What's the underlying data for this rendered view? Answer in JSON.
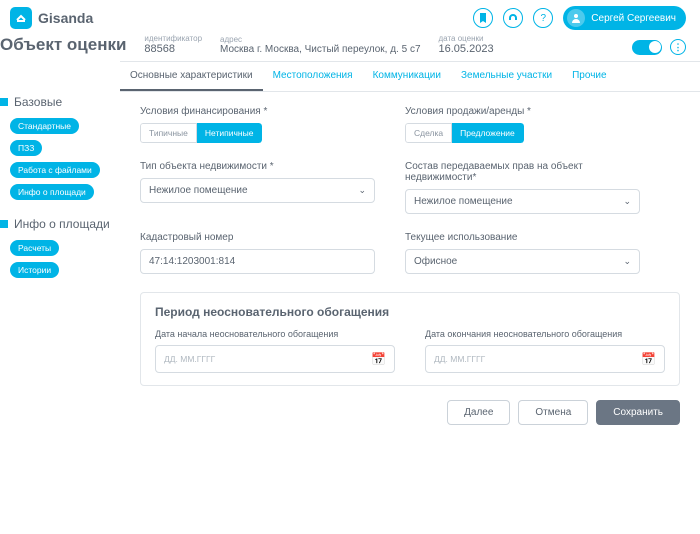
{
  "brand": "Gisanda",
  "header_icons": {
    "bookmark": "bookmark",
    "headset": "support",
    "help": "?"
  },
  "user_name": "Сергей Сергеевич",
  "page_title": "Объект оценки",
  "meta": {
    "id_label": "идентификатор",
    "id_value": "88568",
    "address_label": "адрес",
    "address_value": "Москва г. Москва, Чистый переулок, д. 5 с7",
    "date_label": "дата оценки",
    "date_value": "16.05.2023"
  },
  "sidebar": {
    "group1": {
      "title": "Базовые",
      "items": [
        "Стандартные",
        "ПЗЗ",
        "Работа с файлами",
        "Инфо о площади"
      ]
    },
    "group2": {
      "title": "Инфо о площади",
      "items": [
        "Расчеты",
        "Истории"
      ]
    }
  },
  "tabs": [
    "Основные характеристики",
    "Местоположения",
    "Коммуникации",
    "Земельные участки",
    "Прочие"
  ],
  "form": {
    "financing": {
      "label": "Условия финансирования *",
      "opts": [
        "Типичные",
        "Нетипичные"
      ],
      "selected": 1
    },
    "sale": {
      "label": "Условия продажи/аренды *",
      "opts": [
        "Сделка",
        "Предложение"
      ],
      "selected": 1
    },
    "prop_type": {
      "label": "Тип объекта недвижимости *",
      "value": "Нежилое помещение"
    },
    "rights": {
      "label": "Состав передаваемых прав на объект недвижимости*",
      "value": "Нежилое помещение"
    },
    "cadastral": {
      "label": "Кадастровый номер",
      "value": "47:14:1203001:814"
    },
    "current_use": {
      "label": "Текущее использование",
      "value": "Офисное"
    }
  },
  "period": {
    "title": "Период неосновательного обогащения",
    "start_label": "Дата начала неосновательного обогащения",
    "end_label": "Дата окончания неосновательного обогащения",
    "placeholder": "ДД. ММ.ГГГГ"
  },
  "buttons": {
    "next": "Далее",
    "cancel": "Отмена",
    "save": "Сохранить"
  }
}
